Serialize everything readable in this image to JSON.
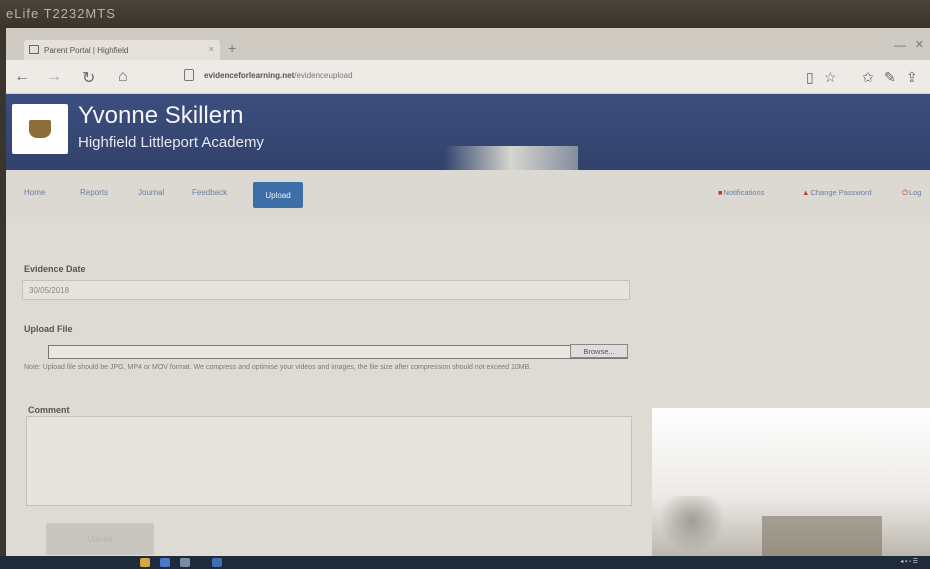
{
  "bezel": {
    "label": "eLife T2232MTS"
  },
  "browser": {
    "tab_title": "Parent Portal | Highfield",
    "tab_close": "×",
    "new_tab": "+",
    "url_domain": "evidenceforlearning.net",
    "url_path": "/evidenceupload",
    "nav_back": "←",
    "nav_forward": "→",
    "nav_refresh": "↻",
    "nav_home": "⌂"
  },
  "header": {
    "title": "Yvonne Skillern",
    "subtitle": "Highfield Littleport Academy"
  },
  "nav": {
    "items": [
      {
        "label": "Home"
      },
      {
        "label": "Reports"
      },
      {
        "label": "Journal"
      },
      {
        "label": "Feedback"
      }
    ],
    "active": "Upload",
    "right": {
      "notifications": "Notifications",
      "change_password": "Change Password",
      "logout": "Log"
    }
  },
  "form": {
    "evidence_date_label": "Evidence Date",
    "evidence_date_value": "30/05/2018",
    "upload_file_label": "Upload File",
    "browse_label": "Browse...",
    "note": "Note:   Upload file should be JPG, MP4 or MOV format. We compress and optimise your videos and images, the file size after compression should not exceed 10MB.",
    "comment_label": "Comment",
    "upload_button": "Upload"
  },
  "colors": {
    "header_bg": "#3c4e7e",
    "nav_active": "#3d6ea8",
    "link": "#6b7ea3",
    "alert": "#c0392b"
  }
}
